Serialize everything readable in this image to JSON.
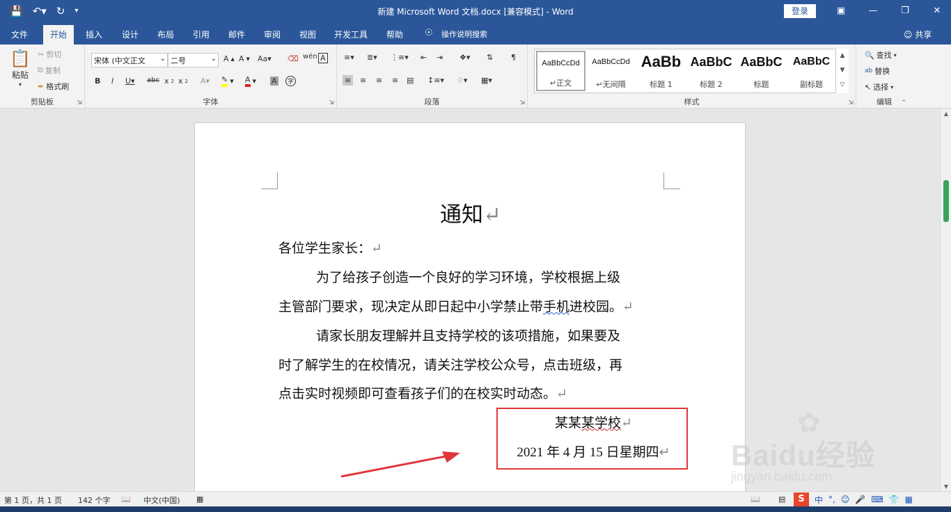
{
  "window": {
    "title": "新建 Microsoft Word 文档.docx [兼容模式] - Word",
    "login": "登录"
  },
  "tabs": [
    {
      "label": "文件"
    },
    {
      "label": "开始"
    },
    {
      "label": "插入"
    },
    {
      "label": "设计"
    },
    {
      "label": "布局"
    },
    {
      "label": "引用"
    },
    {
      "label": "邮件"
    },
    {
      "label": "审阅"
    },
    {
      "label": "视图"
    },
    {
      "label": "开发工具"
    },
    {
      "label": "帮助"
    }
  ],
  "tell_me": "操作说明搜索",
  "share": "共享",
  "ribbon": {
    "clipboard": {
      "label": "剪贴板",
      "paste": "粘贴",
      "cut": "剪切",
      "copy": "复制",
      "format_painter": "格式刷"
    },
    "font": {
      "label": "字体",
      "font_name": "宋体 (中文正文",
      "font_size": "二号"
    },
    "paragraph": {
      "label": "段落"
    },
    "styles": {
      "label": "样式",
      "items": [
        {
          "preview": "AaBbCcDd",
          "name": "↵正文"
        },
        {
          "preview": "AaBbCcDd",
          "name": "↵无间隔"
        },
        {
          "preview": "AaBb",
          "name": "标题 1"
        },
        {
          "preview": "AaBbC",
          "name": "标题 2"
        },
        {
          "preview": "AaBbC",
          "name": "标题"
        },
        {
          "preview": "AaBbC",
          "name": "副标题"
        }
      ]
    },
    "editing": {
      "label": "编辑",
      "find": "查找",
      "replace": "替换",
      "select": "选择"
    }
  },
  "document": {
    "title": "通知",
    "salutation": "各位学生家长：",
    "p1_line1": "为了给孩子创造一个良好的学习环境，学校根据上级",
    "p1_line2_a": "主管部门要求，现决定从即日起中小学禁止带",
    "p1_line2_b": "手机",
    "p1_line2_c": "进校园。",
    "p2_line1": "请家长朋友理解并且支持学校的该项措施，如果要及",
    "p2_line2": "时了解学生的在校情况，请关注学校公众号，点击班级，再",
    "p2_line3": "点击实时视频即可查看孩子们的在校实时动态。",
    "signature_a": "某某",
    "signature_b": "某学校",
    "date": "2021 年 4 月 15 日星期四",
    "para_mark": "↵"
  },
  "status": {
    "page": "第 1 页，共 1 页",
    "words": "142 个字",
    "language": "中文(中国)"
  },
  "watermark": {
    "text": "Baidu经验",
    "url": "jingyan.baidu.com"
  },
  "colors": {
    "title_bar": "#2b579a",
    "highlight_box": "#e0353a",
    "arrow": "#e0353a"
  }
}
